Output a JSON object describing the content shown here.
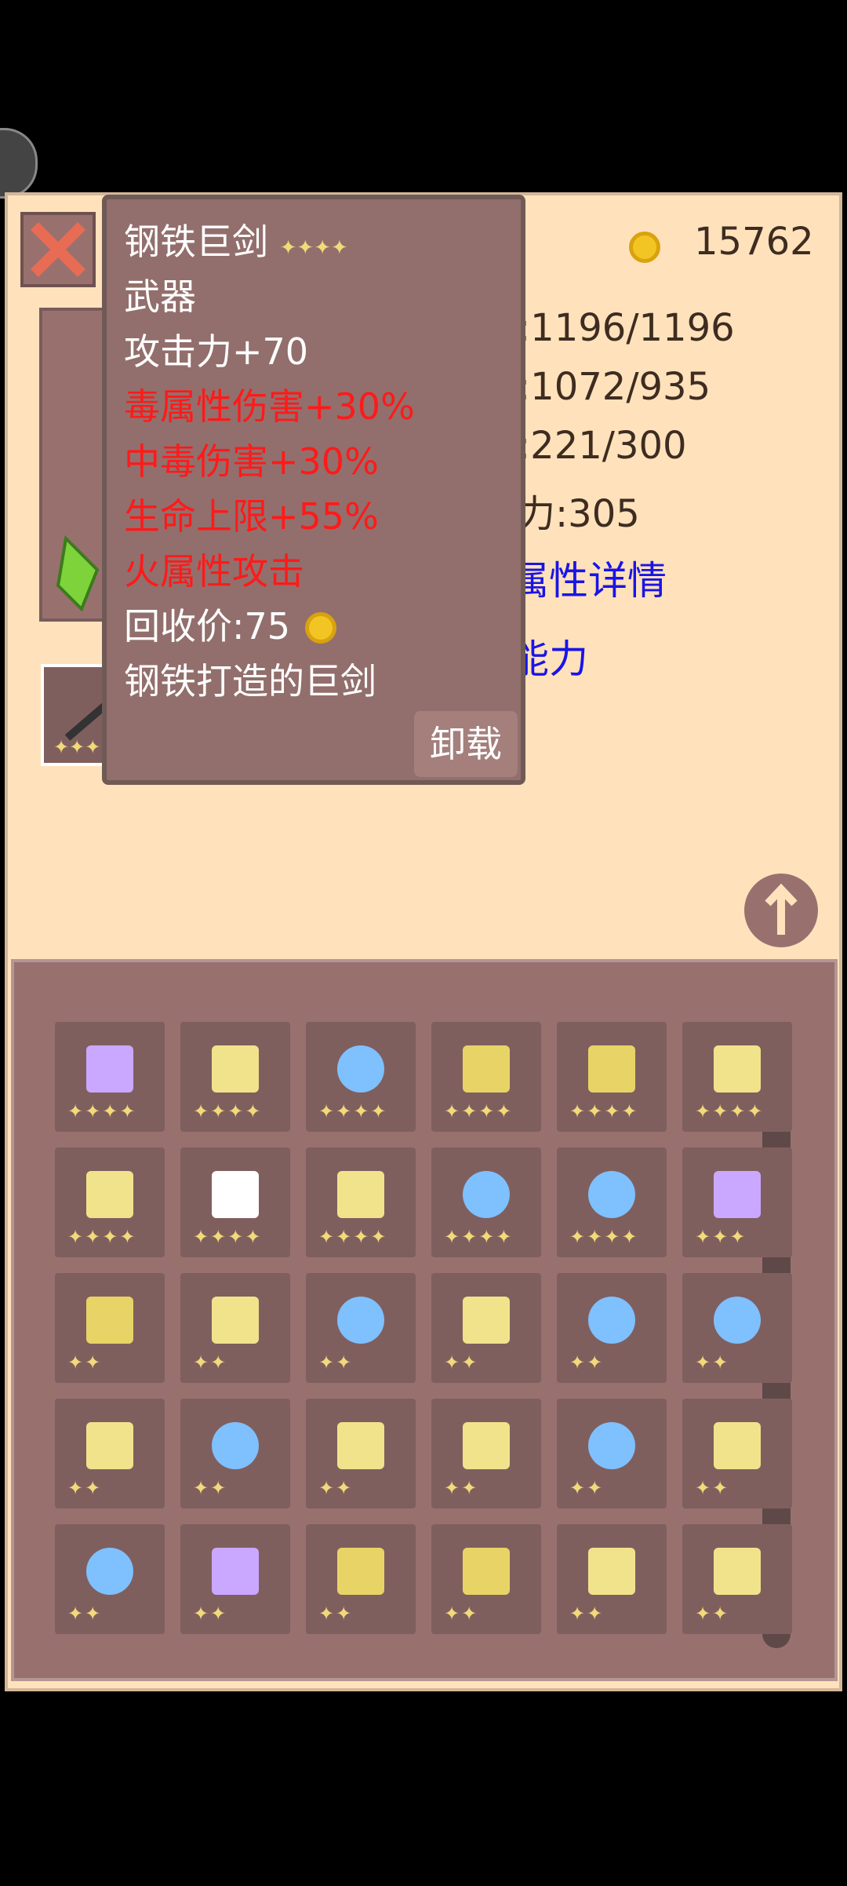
{
  "gold": "15762",
  "stats": {
    "hp": ":1196/1196",
    "mp": ":1072/935",
    "exp": ":221/300",
    "power": "力:305"
  },
  "links": {
    "attr_detail": "属性详情",
    "ability": "能力"
  },
  "tooltip": {
    "name": "钢铁巨剑",
    "name_stars": "✦✦✦✦",
    "type": "武器",
    "attack": "攻击力+70",
    "poison_attr": "毒属性伤害+30%",
    "poisoned_dmg": "中毒伤害+30%",
    "hp_limit": "生命上限+55%",
    "fire_attack": "火属性攻击",
    "recycle": "回收价:75",
    "desc": "钢铁打造的巨剑",
    "unequip": "卸载"
  },
  "equipped": [
    {
      "icon": "sword-icon",
      "stars": "✦✦✦✦"
    },
    {
      "icon": "ring-icon",
      "stars": "✦✦✦✦"
    },
    {
      "icon": "necklace-icon",
      "stars": "✦✦✦✦"
    }
  ],
  "inventory": [
    {
      "icon": "bow-icon",
      "stars": "✦✦✦✦"
    },
    {
      "icon": "sword-icon",
      "stars": "✦✦✦✦"
    },
    {
      "icon": "ring-icon",
      "stars": "✦✦✦✦"
    },
    {
      "icon": "armor-icon",
      "stars": "✦✦✦✦"
    },
    {
      "icon": "armor-icon",
      "stars": "✦✦✦✦"
    },
    {
      "icon": "sword-icon",
      "stars": "✦✦✦✦"
    },
    {
      "icon": "sword-icon",
      "stars": "✦✦✦✦"
    },
    {
      "icon": "necklace-icon",
      "stars": "✦✦✦✦"
    },
    {
      "icon": "sword-icon",
      "stars": "✦✦✦✦"
    },
    {
      "icon": "ring-icon",
      "stars": "✦✦✦✦"
    },
    {
      "icon": "ring-icon",
      "stars": "✦✦✦✦"
    },
    {
      "icon": "bow-icon",
      "stars": "✦✦✦"
    },
    {
      "icon": "armor-icon",
      "stars": "✦✦"
    },
    {
      "icon": "sword-icon",
      "stars": "✦✦"
    },
    {
      "icon": "ring-icon",
      "stars": "✦✦"
    },
    {
      "icon": "sword-icon",
      "stars": "✦✦"
    },
    {
      "icon": "ring-icon",
      "stars": "✦✦"
    },
    {
      "icon": "ring-icon",
      "stars": "✦✦"
    },
    {
      "icon": "sword-icon",
      "stars": "✦✦"
    },
    {
      "icon": "ring-icon",
      "stars": "✦✦"
    },
    {
      "icon": "sword-icon",
      "stars": "✦✦"
    },
    {
      "icon": "sword-icon",
      "stars": "✦✦"
    },
    {
      "icon": "ring-icon",
      "stars": "✦✦"
    },
    {
      "icon": "sword-icon",
      "stars": "✦✦"
    },
    {
      "icon": "ring-icon",
      "stars": "✦✦"
    },
    {
      "icon": "bow-icon",
      "stars": "✦✦"
    },
    {
      "icon": "armor-icon",
      "stars": "✦✦"
    },
    {
      "icon": "armor-icon",
      "stars": "✦✦"
    },
    {
      "icon": "sword-icon",
      "stars": "✦✦"
    },
    {
      "icon": "sword-icon",
      "stars": "✦✦"
    }
  ]
}
